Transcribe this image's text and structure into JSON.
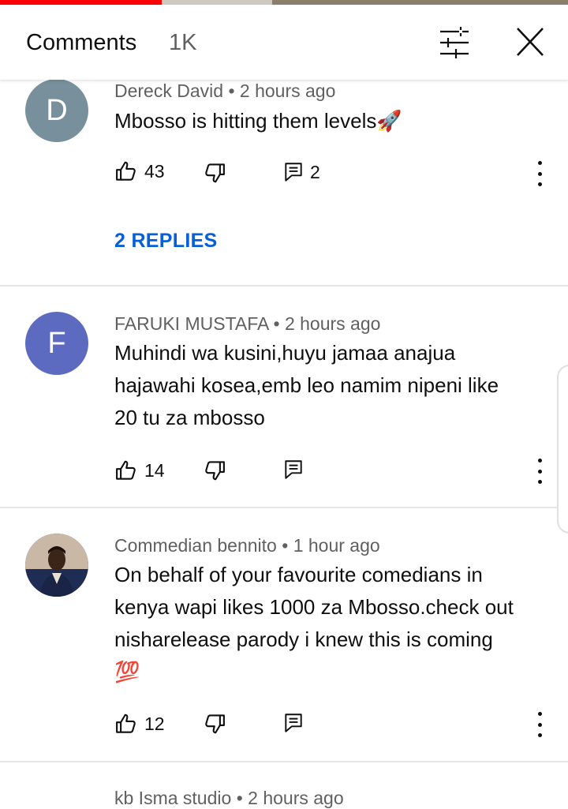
{
  "header": {
    "title": "Comments",
    "count": "1K"
  },
  "comments": [
    {
      "author": "Dereck David",
      "time": "2 hours ago",
      "avatar_letter": "D",
      "avatar_color": "#78909c",
      "text": "Mbosso is hitting them levels🚀",
      "likes": "43",
      "reply_count": "2",
      "replies_label": "2 REPLIES"
    },
    {
      "author": "FARUKI MUSTAFA",
      "time": "2 hours ago",
      "avatar_letter": "F",
      "avatar_color": "#5c6bc0",
      "lines": [
        "Muhindi wa kusini,huyu jamaa anajua",
        "hajawahi kosea,emb leo namim nipeni like",
        "20 tu za mbosso"
      ],
      "likes": "14"
    },
    {
      "author": "Commedian bennito",
      "time": "1 hour ago",
      "lines": [
        "On behalf of your favourite comedians in",
        "kenya wapi likes 1000 za Mbosso.check out",
        "nisharelease parody  i knew this is coming",
        "💯"
      ],
      "likes": "12"
    },
    {
      "author": "kb Isma studio",
      "time": "2 hours ago"
    }
  ],
  "colors": {
    "link_blue": "#065fd4",
    "progress_red": "#ff0000",
    "meta_gray": "#606060"
  },
  "icons": [
    "filter-icon",
    "close-icon",
    "like-icon",
    "dislike-icon",
    "reply-icon",
    "more-icon"
  ]
}
